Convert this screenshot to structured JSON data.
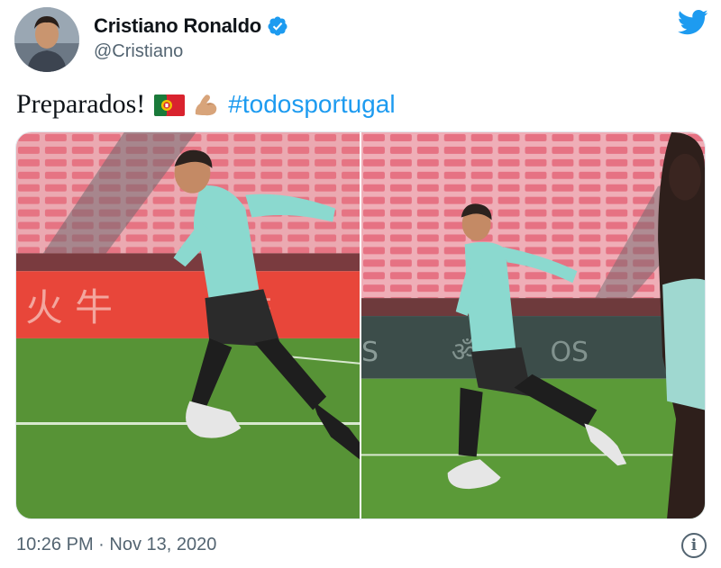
{
  "author": {
    "display_name": "Cristiano Ronaldo",
    "handle": "@Cristiano",
    "verified": true,
    "avatar_icon": "profile-photo"
  },
  "brand": {
    "icon": "twitter-bird-icon",
    "color": "#1d9bf0"
  },
  "tweet": {
    "text": "Preparados!",
    "emojis": [
      "portugal-flag-icon",
      "flexed-biceps-icon"
    ],
    "hashtag": "#todosportugal",
    "hashtag_color": "#1d9bf0"
  },
  "media": {
    "count": 2,
    "photos": [
      {
        "description_icon": "photo-player-sprinting-left"
      },
      {
        "description_icon": "photo-player-sprinting-right"
      }
    ]
  },
  "meta": {
    "timestamp": "10:26 PM · Nov 13, 2020",
    "info_icon": "i"
  }
}
